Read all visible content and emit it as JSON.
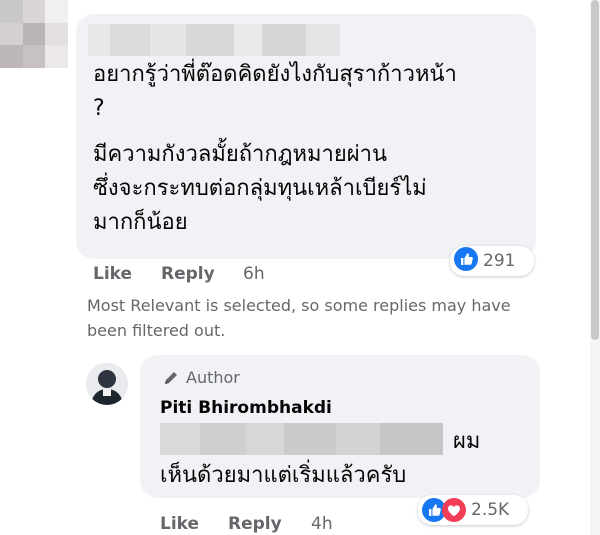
{
  "comment": {
    "text_lines": [
      "อยากรู้ว่าพี่ต๊อดคิดยังไงกับสุราก้าวหน้า",
      "?",
      "มีความกังวลมั้ยถ้ากฎหมายผ่าน",
      "ซึ่งจะกระทบต่อกลุ่มทุนเหล้าเบียร์ไม่",
      "มากก็น้อย"
    ],
    "actions": {
      "like": "Like",
      "reply": "Reply"
    },
    "time": "6h",
    "reactions": {
      "count": "291",
      "icons": [
        "like-icon"
      ]
    }
  },
  "filter_notice": {
    "lines": [
      "Most Relevant is selected, so some replies may have",
      "been filtered out."
    ]
  },
  "reply": {
    "badge": "Author",
    "badge_icon": "pencil-icon",
    "author_name": "Piti Bhirombhakdi",
    "text_line1_end": "ผม",
    "text_line2": "เห็นด้วยมาแต่เริ่มแล้วครับ",
    "actions": {
      "like": "Like",
      "reply": "Reply"
    },
    "time": "4h",
    "reactions": {
      "count": "2.5K",
      "icons": [
        "like-icon",
        "love-icon"
      ]
    }
  },
  "colors": {
    "bubble": "#f0f2f5",
    "secondary_text": "#65676b",
    "like_blue": "#1877f2",
    "love_red": "#f33e58"
  }
}
